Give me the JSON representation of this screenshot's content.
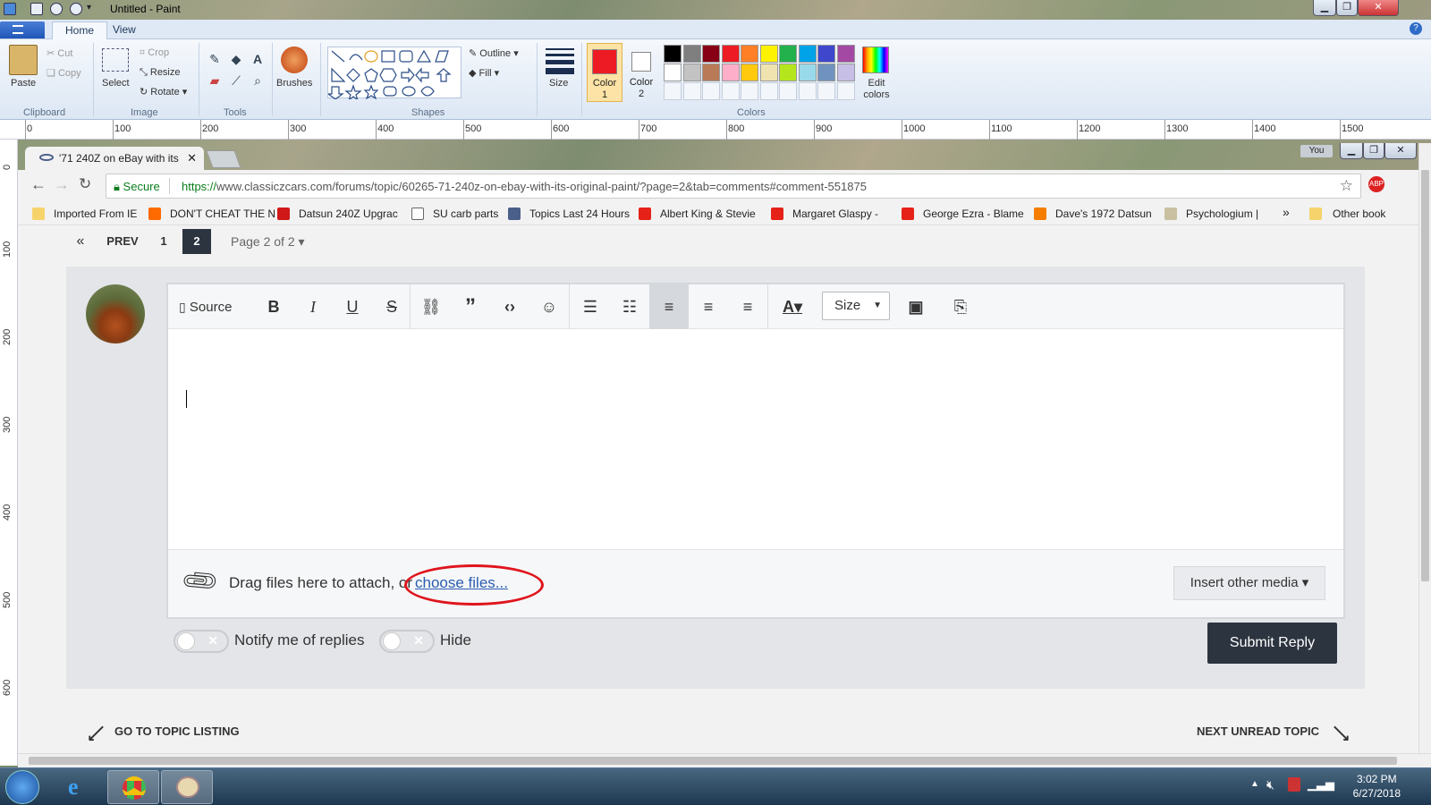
{
  "paint": {
    "title": "Untitled - Paint",
    "tabs": [
      "Home",
      "View"
    ],
    "clipboard": {
      "paste": "Paste",
      "cut": "Cut",
      "copy": "Copy",
      "label": "Clipboard"
    },
    "image": {
      "select": "Select",
      "crop": "Crop",
      "resize": "Resize",
      "rotate": "Rotate",
      "label": "Image"
    },
    "tools_label": "Tools",
    "brushes": "Brushes",
    "shapes": {
      "outline": "Outline",
      "fill": "Fill",
      "label": "Shapes"
    },
    "size": "Size",
    "color1": "Color 1",
    "color2": "Color 2",
    "colors_label": "Colors",
    "edit_colors": "Edit colors",
    "palette_row1": [
      "#000000",
      "#7f7f7f",
      "#880015",
      "#ed1c24",
      "#ff7f27",
      "#fff200",
      "#22b14c",
      "#00a2e8",
      "#3f48cc",
      "#a349a4"
    ],
    "palette_row2": [
      "#ffffff",
      "#c3c3c3",
      "#b97a57",
      "#ffaec9",
      "#ffc90e",
      "#efe4b0",
      "#b5e61d",
      "#99d9ea",
      "#7092be",
      "#c8bfe7"
    ],
    "color1_hex": "#ed1c24",
    "ruler_h": [
      "0",
      "100",
      "200",
      "300",
      "400",
      "500",
      "600",
      "700",
      "800",
      "900",
      "1000",
      "1100",
      "1200",
      "1300",
      "1400",
      "1500"
    ],
    "ruler_v": [
      "0",
      "100",
      "200",
      "300",
      "400",
      "500",
      "600"
    ]
  },
  "browser": {
    "tab_title": "'71 240Z on eBay with its",
    "profile": "You",
    "secure_label": "Secure",
    "url_scheme": "https://",
    "url_rest": "www.classiczcars.com/forums/topic/60265-71-240z-on-ebay-with-its-original-paint/?page=2&tab=comments#comment-551875",
    "bookmarks": [
      "Imported From IE",
      "DON'T CHEAT THE N",
      "Datsun 240Z Upgrac",
      "SU carb parts",
      "Topics Last 24 Hours",
      "Albert King & Stevie",
      "Margaret Glaspy - ",
      "George Ezra - Blame",
      "Dave's 1972 Datsun",
      "Psychologium |"
    ],
    "more": "»",
    "other_bookmarks": "Other book"
  },
  "forum": {
    "pagination": {
      "first": "«",
      "prev": "PREV",
      "page1": "1",
      "page2": "2",
      "page_info": "Page 2 of 2"
    },
    "toolbar": {
      "source": "Source",
      "bold": "B",
      "italic": "I",
      "underline": "U",
      "strike": "S",
      "size": "Size"
    },
    "attach_text": "Drag files here to attach, or ",
    "choose_files": "choose files...",
    "insert_media": "Insert other media",
    "notify": "Notify me of replies",
    "hide": "Hide",
    "submit": "Submit Reply",
    "go_to_topic": "GO TO TOPIC LISTING",
    "next_unread": "NEXT UNREAD TOPIC"
  },
  "taskbar": {
    "time": "3:02 PM",
    "date": "6/27/2018"
  }
}
